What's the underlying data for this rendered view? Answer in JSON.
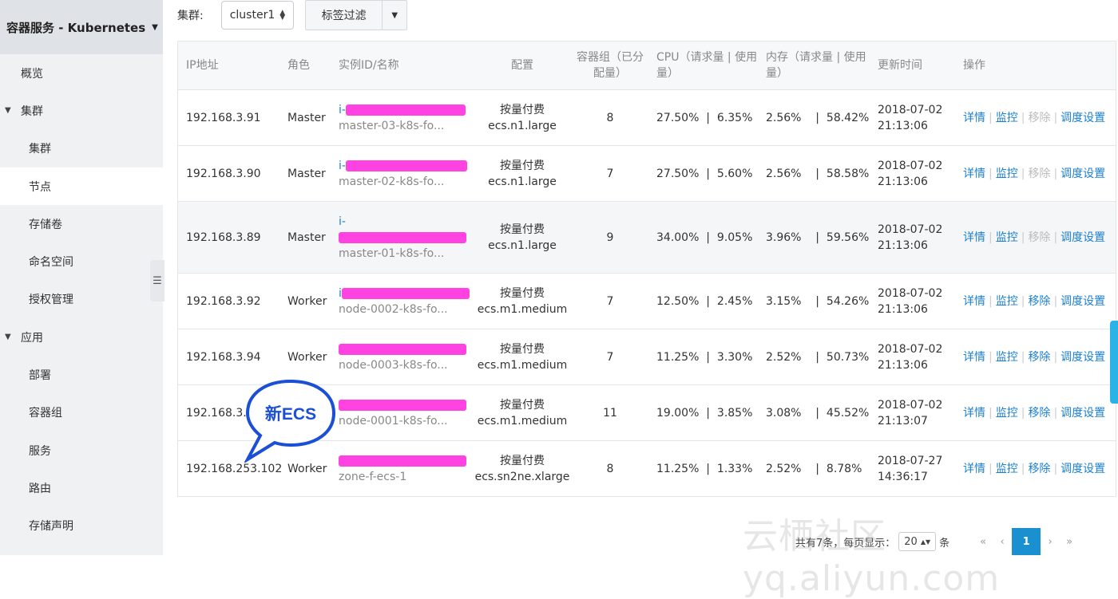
{
  "sidebar": {
    "title": "容器服务 - Kubernetes",
    "items": [
      {
        "label": "概览",
        "kind": "l1"
      },
      {
        "label": "集群",
        "kind": "group"
      },
      {
        "label": "集群",
        "kind": "l2"
      },
      {
        "label": "节点",
        "kind": "l2",
        "active": true
      },
      {
        "label": "存储卷",
        "kind": "l2"
      },
      {
        "label": "命名空间",
        "kind": "l2"
      },
      {
        "label": "授权管理",
        "kind": "l2"
      },
      {
        "label": "应用",
        "kind": "group"
      },
      {
        "label": "部署",
        "kind": "l2"
      },
      {
        "label": "容器组",
        "kind": "l2"
      },
      {
        "label": "服务",
        "kind": "l2"
      },
      {
        "label": "路由",
        "kind": "l2"
      },
      {
        "label": "存储声明",
        "kind": "l2"
      }
    ]
  },
  "toolbar": {
    "cluster_label": "集群:",
    "cluster_value": "cluster1",
    "tag_filter": "标签过滤"
  },
  "table": {
    "headers": {
      "ip": "IP地址",
      "role": "角色",
      "instance": "实例ID/名称",
      "config": "配置",
      "pods": "容器组（已分配量）",
      "cpu": "CPU（请求量 | 使用量）",
      "mem": "内存（请求量 | 使用量）",
      "time": "更新时间",
      "ops": "操作"
    },
    "ops_labels": {
      "detail": "详情",
      "monitor": "监控",
      "remove": "移除",
      "schedule": "调度设置"
    },
    "rows": [
      {
        "ip": "192.168.3.91",
        "role": "Master",
        "id_prefix": "i-",
        "name": "master-03-k8s-fo...",
        "billing": "按量付费",
        "spec": "ecs.n1.large",
        "pods": "8",
        "cpu_req": "27.50%",
        "cpu_use": "6.35%",
        "mem_req": "2.56%",
        "mem_use": "58.42%",
        "date": "2018-07-02",
        "time": "21:13:06",
        "removable": false
      },
      {
        "ip": "192.168.3.90",
        "role": "Master",
        "id_prefix": "i-",
        "name": "master-02-k8s-fo...",
        "billing": "按量付费",
        "spec": "ecs.n1.large",
        "pods": "7",
        "cpu_req": "27.50%",
        "cpu_use": "5.60%",
        "mem_req": "2.56%",
        "mem_use": "58.58%",
        "date": "2018-07-02",
        "time": "21:13:06",
        "removable": false
      },
      {
        "ip": "192.168.3.89",
        "role": "Master",
        "id_prefix": "i-",
        "name": "master-01-k8s-fo...",
        "billing": "按量付费",
        "spec": "ecs.n1.large",
        "pods": "9",
        "cpu_req": "34.00%",
        "cpu_use": "9.05%",
        "mem_req": "3.96%",
        "mem_use": "59.56%",
        "date": "2018-07-02",
        "time": "21:13:06",
        "removable": false,
        "tall": true
      },
      {
        "ip": "192.168.3.92",
        "role": "Worker",
        "id_prefix": "i",
        "name": "node-0002-k8s-fo...",
        "billing": "按量付费",
        "spec": "ecs.m1.medium",
        "pods": "7",
        "cpu_req": "12.50%",
        "cpu_use": "2.45%",
        "mem_req": "3.15%",
        "mem_use": "54.26%",
        "date": "2018-07-02",
        "time": "21:13:06",
        "removable": true
      },
      {
        "ip": "192.168.3.94",
        "role": "Worker",
        "id_prefix": "",
        "name": "node-0003-k8s-fo...",
        "billing": "按量付费",
        "spec": "ecs.m1.medium",
        "pods": "7",
        "cpu_req": "11.25%",
        "cpu_use": "3.30%",
        "mem_req": "2.52%",
        "mem_use": "50.73%",
        "date": "2018-07-02",
        "time": "21:13:06",
        "removable": true
      },
      {
        "ip": "192.168.3.9",
        "role": "",
        "id_prefix": "",
        "name": "node-0001-k8s-fo...",
        "billing": "按量付费",
        "spec": "ecs.m1.medium",
        "pods": "11",
        "cpu_req": "19.00%",
        "cpu_use": "3.85%",
        "mem_req": "3.08%",
        "mem_use": "45.52%",
        "date": "2018-07-02",
        "time": "21:13:07",
        "removable": true
      },
      {
        "ip": "192.168.253.102",
        "role": "Worker",
        "id_prefix": "",
        "name": "zone-f-ecs-1",
        "billing": "按量付费",
        "spec": "ecs.sn2ne.xlarge",
        "pods": "8",
        "cpu_req": "11.25%",
        "cpu_use": "1.33%",
        "mem_req": "2.52%",
        "mem_use": "8.78%",
        "date": "2018-07-27",
        "time": "14:36:17",
        "removable": true
      }
    ]
  },
  "annotation": {
    "text": "新ECS",
    "color": "#1a4fd6"
  },
  "pager": {
    "total": "共有7条，每页显示：",
    "page_size": "20",
    "unit": "条",
    "first": "«",
    "prev": "‹",
    "current": "1",
    "next": "›",
    "last": "»"
  },
  "watermark": "云栖社区 yq.aliyun.com",
  "colors": {
    "link": "#1a7fd1",
    "redaction": "#ff43e3",
    "pager_active": "#1a90d0"
  }
}
